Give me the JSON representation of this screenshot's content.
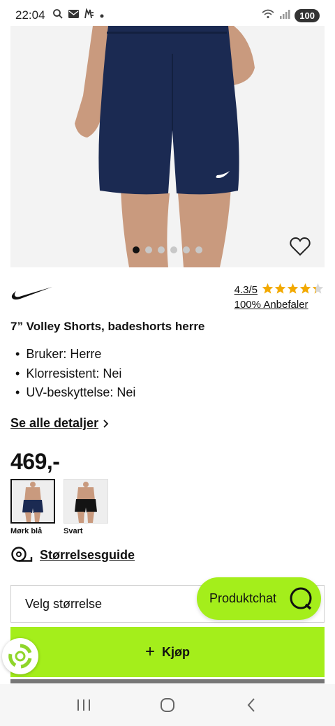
{
  "status_bar": {
    "time": "22:04",
    "battery": "100"
  },
  "product": {
    "brand_logo": "nike-swoosh",
    "rating": "4.3/5",
    "stars": "★★★★★",
    "recommend": "100% Anbefaler",
    "title": "7” Volley Shorts, badeshorts herre",
    "features": [
      "Bruker: Herre",
      "Klorresistent: Nei",
      "UV-beskyttelse: Nei"
    ],
    "details_link": "Se alle detaljer",
    "price": "469,-",
    "gallery_dots": 6,
    "gallery_active_index": 0,
    "rating_value": 4.3,
    "variants": [
      {
        "label": "Mørk blå",
        "color": "#1b2a52",
        "selected": true
      },
      {
        "label": "Svart",
        "color": "#141414",
        "selected": false
      }
    ],
    "size_guide": "Størrelsesguide",
    "size_select_placeholder": "Velg størrelse",
    "buy_label": "Kjøp"
  },
  "chat": {
    "label": "Produktchat"
  },
  "colors": {
    "accent": "#a4ee1b",
    "shorts": "#1b2a52",
    "stars": "#f2a900"
  },
  "icons": {
    "favorite": "heart-outline-icon",
    "chevron": "chevron-right-icon",
    "size_guide": "measuring-tape-icon",
    "chat": "chat-bubble-icon",
    "buy": "plus-icon",
    "recycle": "recycle-icon",
    "nav_recents": "recents-icon",
    "nav_home": "home-icon",
    "nav_back": "back-icon"
  }
}
